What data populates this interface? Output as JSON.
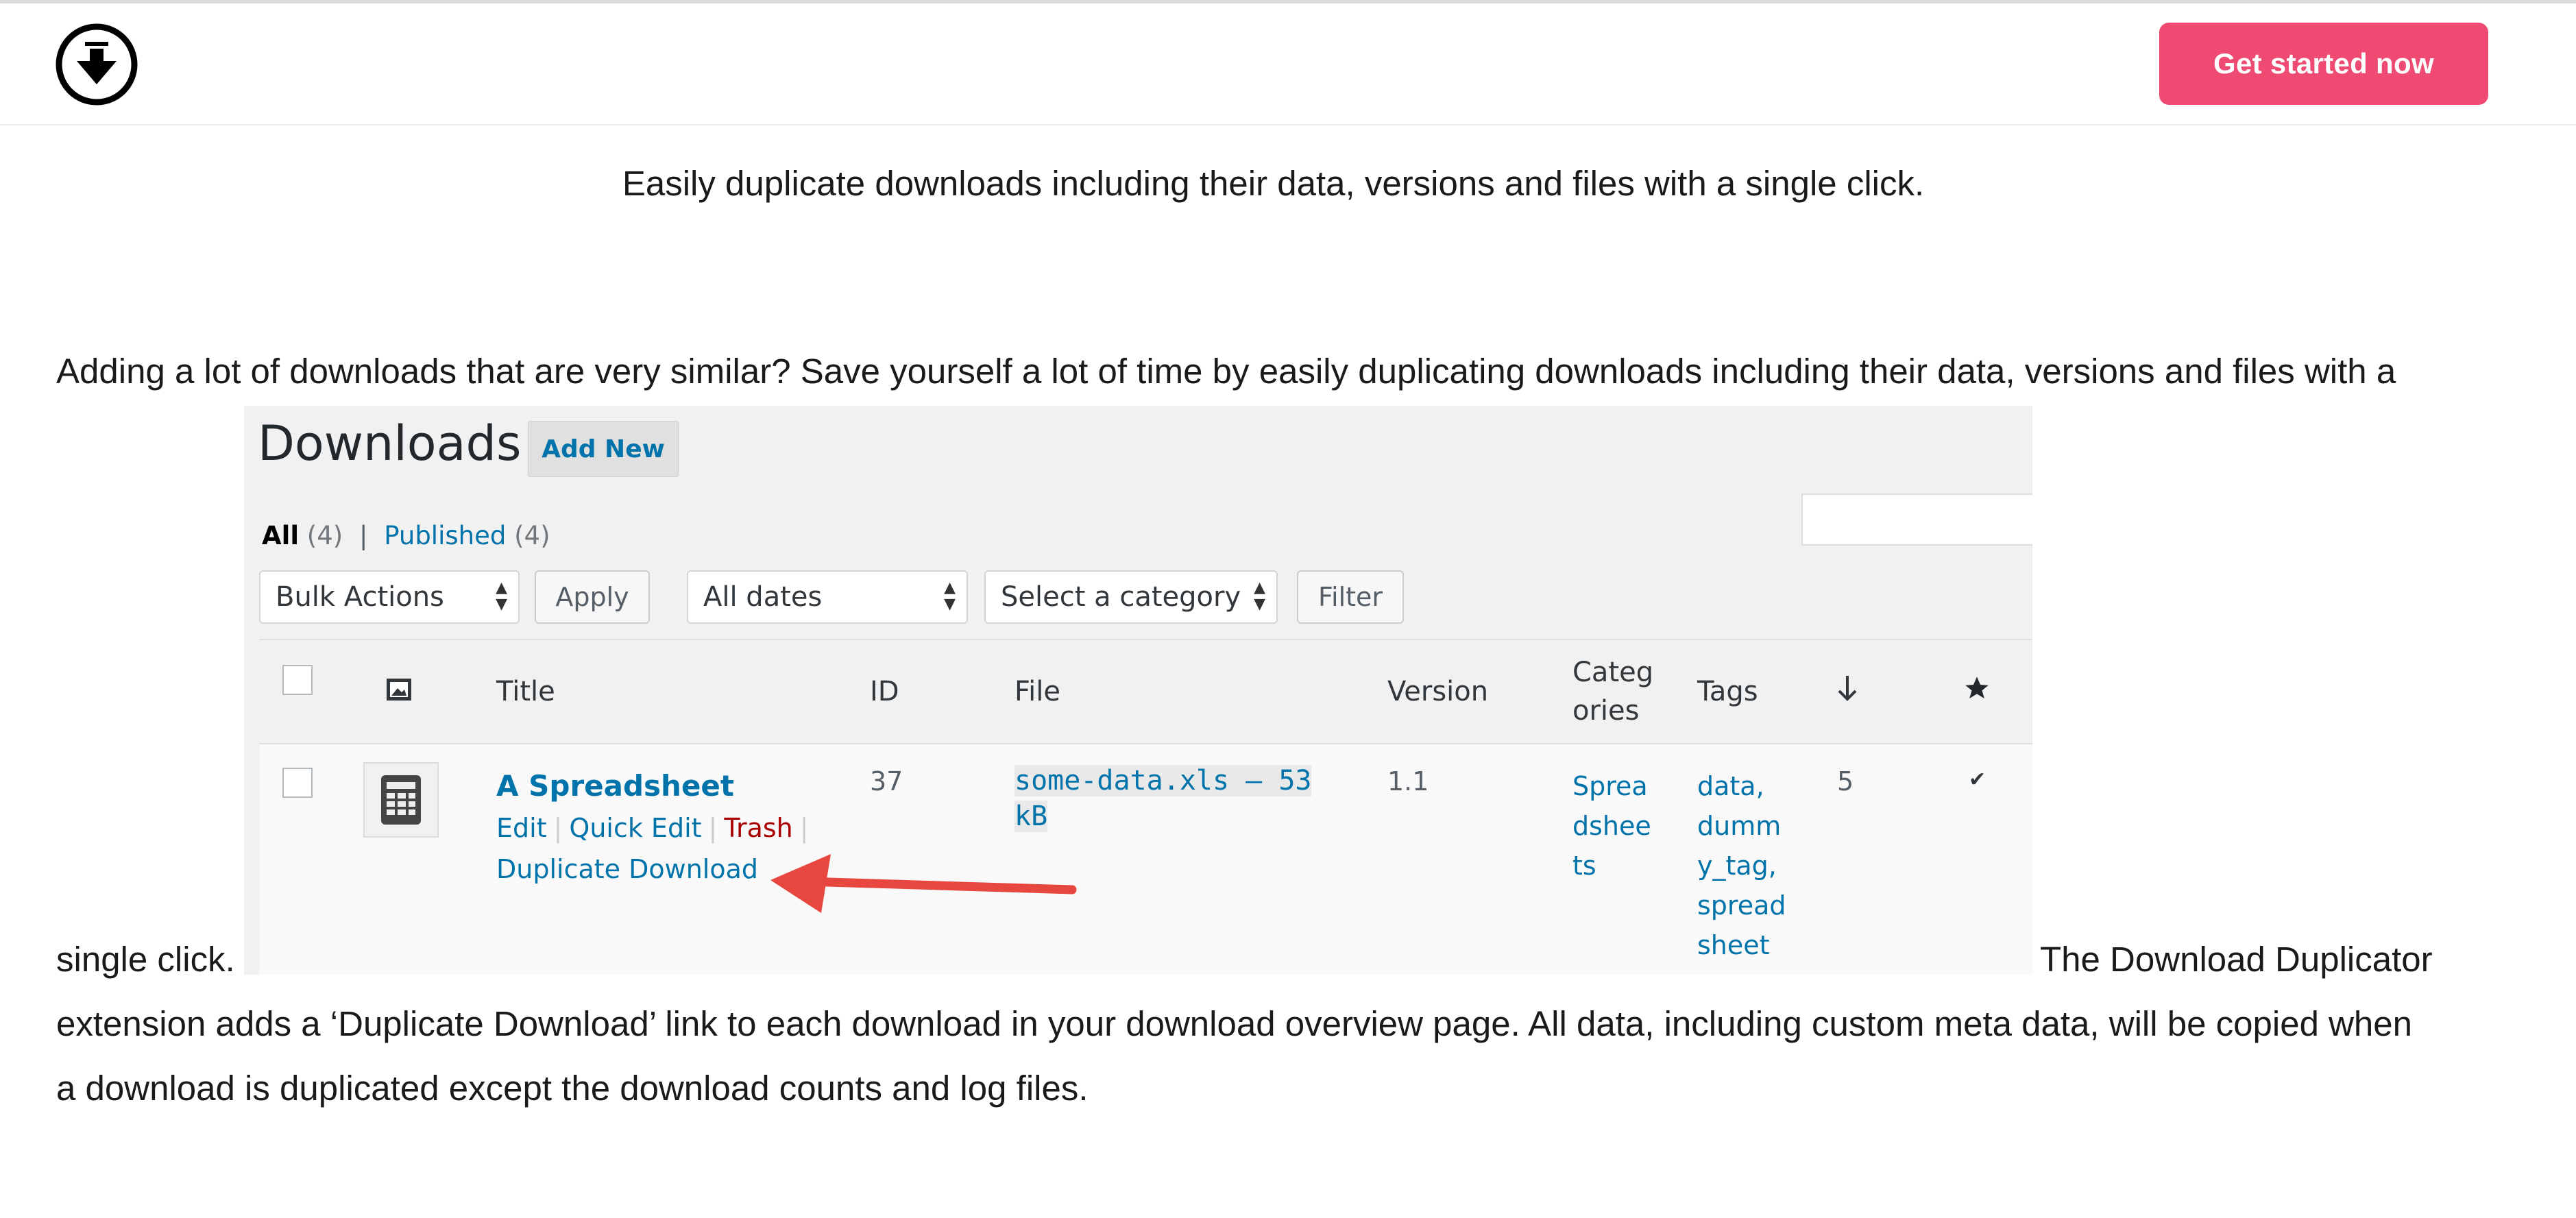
{
  "header": {
    "logo_icon": "download-arrow-circle-icon",
    "cta_label": "Get started now",
    "cta_color": "#ee4a72"
  },
  "content": {
    "tagline": "Easily duplicate downloads including their data, versions and files with a single click.",
    "para_line1": "Adding a lot of downloads that are very similar? Save yourself a lot of time by easily duplicating downloads including their data, versions and files with a",
    "para_inline_start": "single click.",
    "para_inline_end": "The Download Duplicator",
    "para_line3": "extension adds a ‘Duplicate Download’ link to each download in your download overview page. All data, including custom meta data, will be copied when",
    "para_line4": "a download is duplicated except the download counts and log files."
  },
  "screenshot": {
    "page_title": "Downloads",
    "add_new": "Add New",
    "filters": {
      "all_label": "All",
      "all_count": "(4)",
      "separator": "|",
      "published_label": "Published",
      "published_count": "(4)"
    },
    "bulk_actions": "Bulk Actions",
    "apply": "Apply",
    "dates": "All dates",
    "category": "Select a category",
    "filter": "Filter",
    "columns": {
      "title": "Title",
      "id": "ID",
      "file": "File",
      "version": "Version",
      "categories_1": "Categ",
      "categories_2": "ories",
      "tags": "Tags",
      "downloads_icon": "download-arrow-icon",
      "featured_icon": "star-icon"
    },
    "row": {
      "title": "A Spreadsheet",
      "id": "37",
      "file_1": " some-data.xls – 53",
      "file_2": "kB",
      "version": "1.1",
      "category_lines": [
        "Sprea",
        "dshee",
        "ts"
      ],
      "tag_lines": [
        "data,",
        "dumm",
        "y_tag,",
        "spread",
        "sheet"
      ],
      "count": "5",
      "featured": "✔",
      "actions": {
        "edit": "Edit",
        "quick_edit": "Quick Edit",
        "trash": "Trash",
        "sep": "|",
        "duplicate": "Duplicate Download"
      }
    },
    "annotation_color": "#e8473f"
  }
}
